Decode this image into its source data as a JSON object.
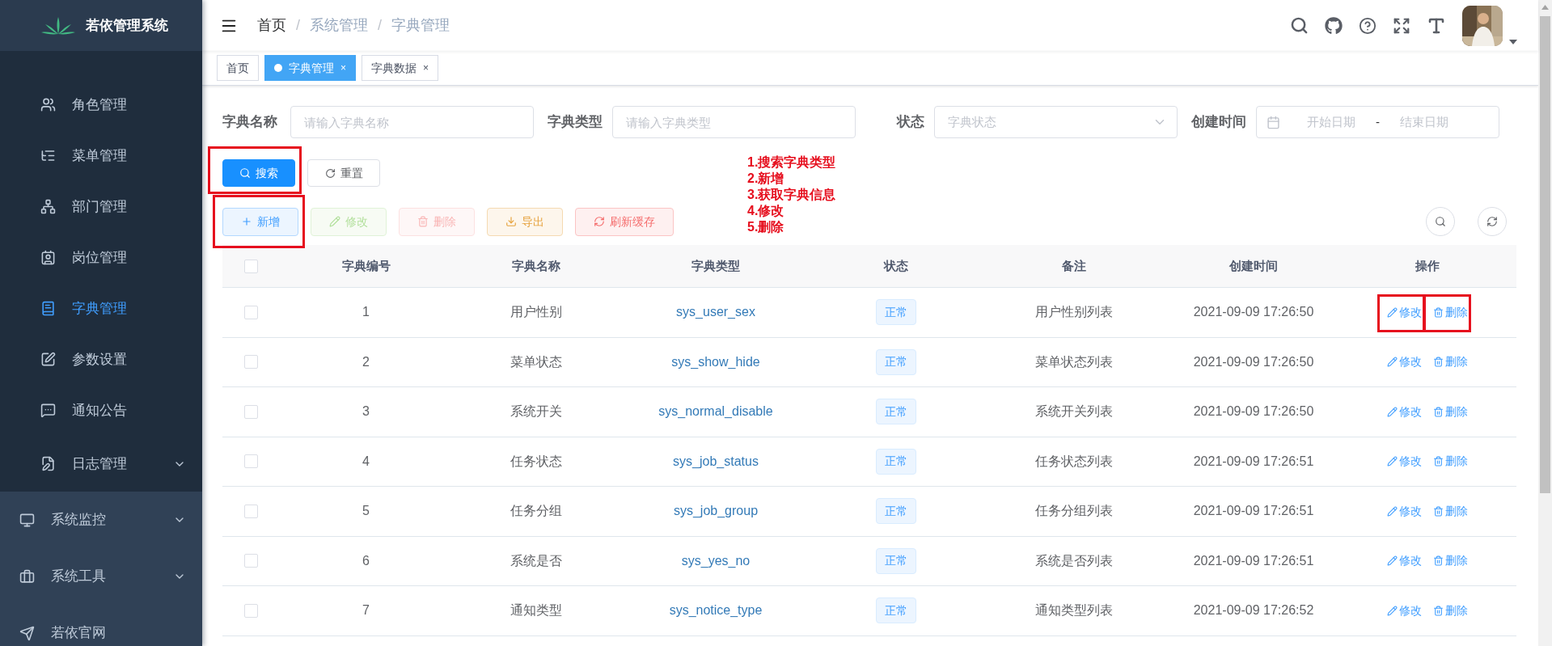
{
  "sidebar": {
    "title": "若依管理系统",
    "items": [
      {
        "label": "角色管理",
        "kind": "item",
        "selected": false
      },
      {
        "label": "菜单管理",
        "kind": "item",
        "selected": false
      },
      {
        "label": "部门管理",
        "kind": "item",
        "selected": false
      },
      {
        "label": "岗位管理",
        "kind": "item",
        "selected": false
      },
      {
        "label": "字典管理",
        "kind": "item",
        "selected": true
      },
      {
        "label": "参数设置",
        "kind": "item",
        "selected": false
      },
      {
        "label": "通知公告",
        "kind": "item",
        "selected": false
      },
      {
        "label": "日志管理",
        "kind": "submenu",
        "selected": false,
        "expanded": false
      }
    ],
    "groups": [
      {
        "label": "系统监控",
        "kind": "submenu",
        "expanded": false
      },
      {
        "label": "系统工具",
        "kind": "submenu",
        "expanded": false
      },
      {
        "label": "若依官网",
        "kind": "link"
      }
    ]
  },
  "breadcrumb": [
    {
      "label": "首页",
      "kind": "link"
    },
    {
      "label": "系统管理",
      "kind": "text",
      "separator": "/"
    },
    {
      "label": "字典管理",
      "kind": "text",
      "separator": "/"
    }
  ],
  "tags": [
    {
      "label": "首页",
      "selected": false
    },
    {
      "label": "字典管理",
      "selected": true,
      "close": "×"
    },
    {
      "label": "字典数据",
      "selected": false,
      "close": "×"
    }
  ],
  "search_form": [
    {
      "label": "字典名称",
      "kind": "input",
      "placeholder": "请输入字典名称"
    },
    {
      "label": "字典类型",
      "kind": "input",
      "placeholder": "请输入字典类型"
    },
    {
      "label": "状态",
      "kind": "select",
      "placeholder": "字典状态"
    },
    {
      "label": "创建时间",
      "kind": "daterange",
      "start_placeholder": "开始日期",
      "separator": "-",
      "end_placeholder": "结束日期"
    }
  ],
  "form_buttons": [
    {
      "label": "搜索",
      "kind": "primary",
      "highlighted": true
    },
    {
      "label": "重置",
      "kind": "default",
      "highlighted": false
    }
  ],
  "toolbar": [
    {
      "label": "新增",
      "kind": "primary",
      "disabled": false,
      "highlighted": true
    },
    {
      "label": "修改",
      "kind": "success",
      "disabled": true,
      "highlighted": false
    },
    {
      "label": "删除",
      "kind": "danger",
      "disabled": true,
      "highlighted": false
    },
    {
      "label": "导出",
      "kind": "warning",
      "disabled": false,
      "highlighted": false
    },
    {
      "label": "刷新缓存",
      "kind": "danger",
      "disabled": false,
      "highlighted": false
    }
  ],
  "annotation": [
    "1.搜索字典类型",
    "2.新增",
    "3.获取字典信息",
    "4.修改",
    "5.删除"
  ],
  "table": {
    "header_checked": false,
    "columns": [
      "字典编号",
      "字典名称",
      "字典类型",
      "状态",
      "备注",
      "创建时间",
      "操作"
    ],
    "rows": [
      {
        "checked": false,
        "id": "1",
        "name": "用户性别",
        "type": "sys_user_sex",
        "status": "正常",
        "remark": "用户性别列表",
        "created": "2021-09-09 17:26:50",
        "actions": [
          {
            "label": "修改",
            "kind": "edit",
            "highlighted": true
          },
          {
            "label": "删除",
            "kind": "delete",
            "highlighted": true
          }
        ]
      },
      {
        "checked": false,
        "id": "2",
        "name": "菜单状态",
        "type": "sys_show_hide",
        "status": "正常",
        "remark": "菜单状态列表",
        "created": "2021-09-09 17:26:50",
        "actions": [
          {
            "label": "修改",
            "kind": "edit",
            "highlighted": false
          },
          {
            "label": "删除",
            "kind": "delete",
            "highlighted": false
          }
        ]
      },
      {
        "checked": false,
        "id": "3",
        "name": "系统开关",
        "type": "sys_normal_disable",
        "status": "正常",
        "remark": "系统开关列表",
        "created": "2021-09-09 17:26:50",
        "actions": [
          {
            "label": "修改",
            "kind": "edit",
            "highlighted": false
          },
          {
            "label": "删除",
            "kind": "delete",
            "highlighted": false
          }
        ]
      },
      {
        "checked": false,
        "id": "4",
        "name": "任务状态",
        "type": "sys_job_status",
        "status": "正常",
        "remark": "任务状态列表",
        "created": "2021-09-09 17:26:51",
        "actions": [
          {
            "label": "修改",
            "kind": "edit",
            "highlighted": false
          },
          {
            "label": "删除",
            "kind": "delete",
            "highlighted": false
          }
        ]
      },
      {
        "checked": false,
        "id": "5",
        "name": "任务分组",
        "type": "sys_job_group",
        "status": "正常",
        "remark": "任务分组列表",
        "created": "2021-09-09 17:26:51",
        "actions": [
          {
            "label": "修改",
            "kind": "edit",
            "highlighted": false
          },
          {
            "label": "删除",
            "kind": "delete",
            "highlighted": false
          }
        ]
      },
      {
        "checked": false,
        "id": "6",
        "name": "系统是否",
        "type": "sys_yes_no",
        "status": "正常",
        "remark": "系统是否列表",
        "created": "2021-09-09 17:26:51",
        "actions": [
          {
            "label": "修改",
            "kind": "edit",
            "highlighted": false
          },
          {
            "label": "删除",
            "kind": "delete",
            "highlighted": false
          }
        ]
      },
      {
        "checked": false,
        "id": "7",
        "name": "通知类型",
        "type": "sys_notice_type",
        "status": "正常",
        "remark": "通知类型列表",
        "created": "2021-09-09 17:26:52",
        "actions": [
          {
            "label": "修改",
            "kind": "edit",
            "highlighted": false
          },
          {
            "label": "删除",
            "kind": "delete",
            "highlighted": false
          }
        ]
      }
    ]
  }
}
